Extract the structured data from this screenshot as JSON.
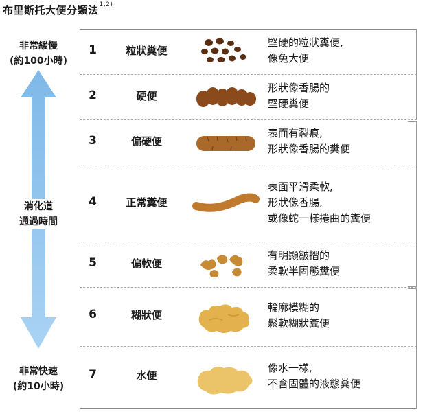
{
  "title": "布里斯托大便分類法",
  "title_sup": "1,2)",
  "side": {
    "slow_line1": "非常緩慢",
    "slow_line2": "(約100小時)",
    "mid_line1": "消化道",
    "mid_line2": "通過時間",
    "fast_line1": "非常快速",
    "fast_line2": "(約10小時)"
  },
  "rows": [
    {
      "num": "1",
      "name": "粒狀糞便",
      "desc1": "堅硬的粒狀糞便,",
      "desc2": "像兔大便",
      "desc3": ""
    },
    {
      "num": "2",
      "name": "硬便",
      "desc1": "形狀像香腸的",
      "desc2": "堅硬糞便",
      "desc3": ""
    },
    {
      "num": "3",
      "name": "偏硬便",
      "desc1": "表面有裂痕,",
      "desc2": "形狀像香腸的糞便",
      "desc3": ""
    },
    {
      "num": "4",
      "name": "正常糞便",
      "desc1": "表面平滑柔軟,",
      "desc2": "形狀像香腸,",
      "desc3": "或像蛇一樣捲曲的糞便"
    },
    {
      "num": "5",
      "name": "偏軟便",
      "desc1": "有明顯皺摺的",
      "desc2": "柔軟半固態糞便",
      "desc3": ""
    },
    {
      "num": "6",
      "name": "糊狀便",
      "desc1": "輪廓模糊的",
      "desc2": "鬆軟糊狀糞便",
      "desc3": ""
    },
    {
      "num": "7",
      "name": "水便",
      "desc1": "像水一樣,",
      "desc2": "不含固體的液態糞便",
      "desc3": ""
    }
  ],
  "colors": {
    "arrow": "#7fb9e8",
    "dark_brown": "#5a2e12",
    "brown": "#8a4a1c",
    "mid_brown": "#a9692a",
    "tan": "#c68a35",
    "yellow": "#e3b24f",
    "light_yellow": "#ebc46a",
    "rule": "#888888"
  }
}
